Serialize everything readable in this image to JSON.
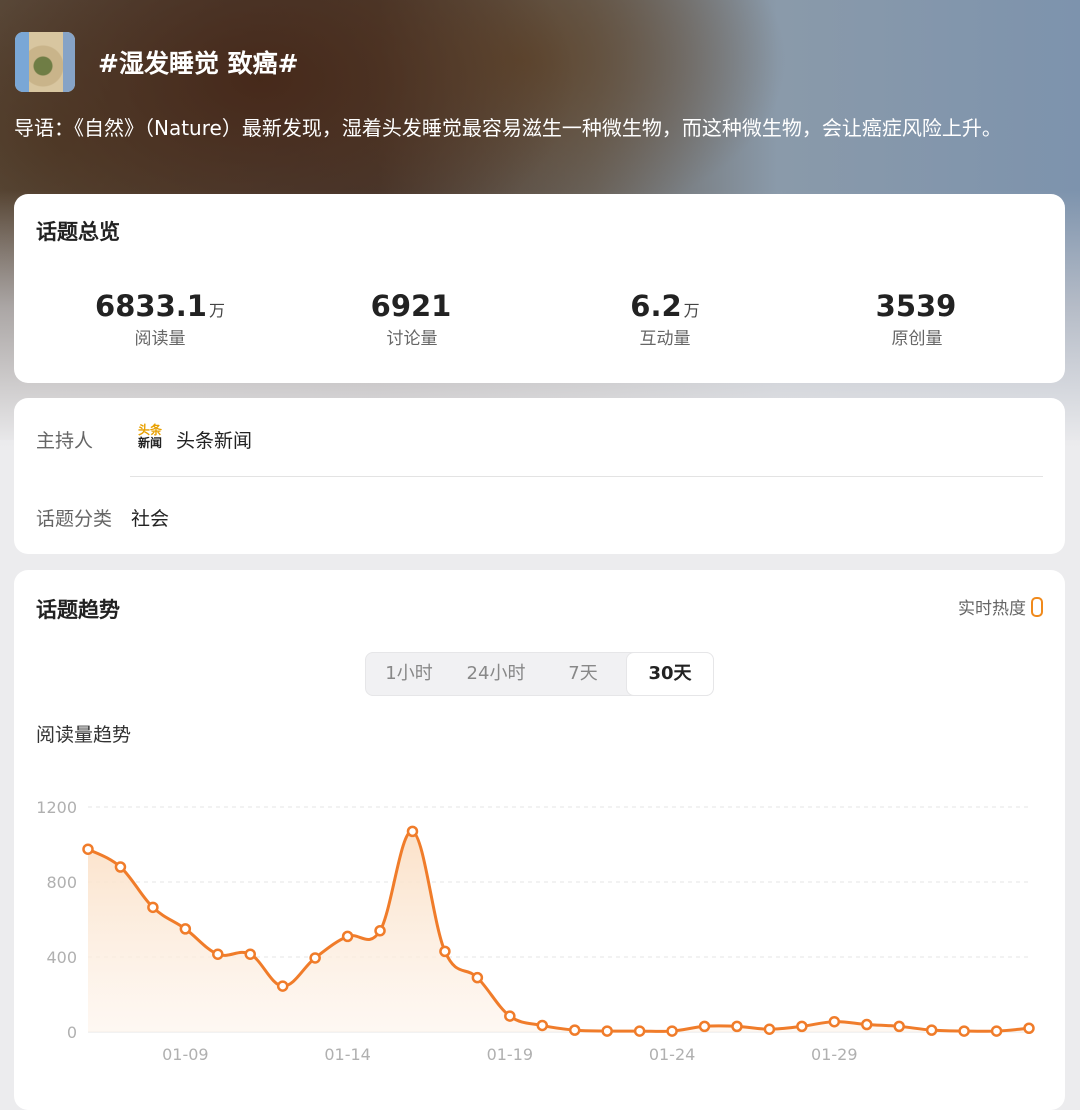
{
  "topic": {
    "title": "#湿发睡觉 致癌#",
    "intro": "导语：《自然》（Nature）最新发现，湿着头发睡觉最容易滋生一种微生物，而这种微生物，会让癌症风险上升。"
  },
  "overview": {
    "title": "话题总览",
    "stats": [
      {
        "value": "6833.1",
        "unit": "万",
        "label": "阅读量"
      },
      {
        "value": "6921",
        "unit": "",
        "label": "讨论量"
      },
      {
        "value": "6.2",
        "unit": "万",
        "label": "互动量"
      },
      {
        "value": "3539",
        "unit": "",
        "label": "原创量"
      }
    ]
  },
  "info": {
    "host_label": "主持人",
    "host_logo_top": "头条",
    "host_logo_bottom": "新闻",
    "host_name": "头条新闻",
    "category_label": "话题分类",
    "category_value": "社会"
  },
  "trend": {
    "title": "话题趋势",
    "realtime_label": "实时热度",
    "realtime_icon": "flame-icon",
    "tabs": [
      "1小时",
      "24小时",
      "7天",
      "30天"
    ],
    "active_tab": "30天",
    "chart_title": "阅读量趋势"
  },
  "colors": {
    "accent": "#f07c2a",
    "fill_top": "#fbe3cc"
  },
  "chart_data": {
    "type": "area",
    "title": "阅读量趋势",
    "xlabel": "",
    "ylabel": "",
    "ylim": [
      0,
      1200
    ],
    "yticks": [
      0,
      400,
      800,
      1200
    ],
    "x_tick_labels": [
      {
        "index": 3,
        "label": "01-09"
      },
      {
        "index": 8,
        "label": "01-14"
      },
      {
        "index": 13,
        "label": "01-19"
      },
      {
        "index": 18,
        "label": "01-24"
      },
      {
        "index": 23,
        "label": "01-29"
      }
    ],
    "grid": true,
    "series": [
      {
        "values": [
          975,
          880,
          665,
          550,
          415,
          415,
          245,
          395,
          510,
          540,
          1070,
          430,
          290,
          85,
          35,
          10,
          5,
          5,
          5,
          30,
          30,
          15,
          30,
          55,
          40,
          30,
          10,
          5,
          5,
          20
        ]
      }
    ]
  }
}
